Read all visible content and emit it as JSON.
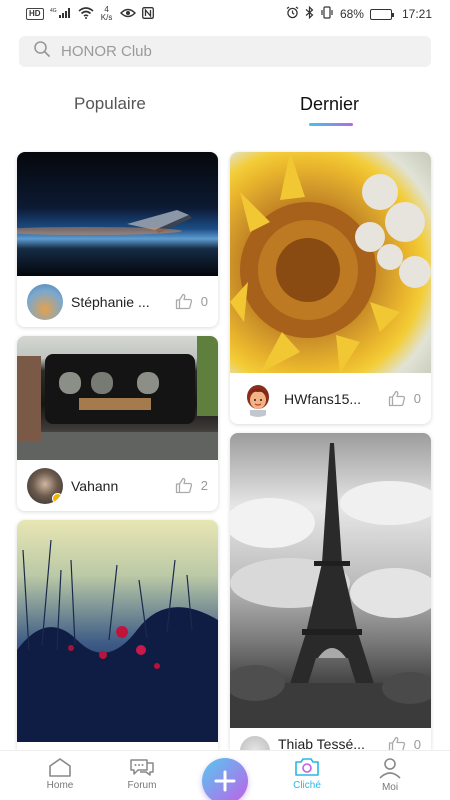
{
  "status_bar": {
    "hd": "HD",
    "net_type": "4G",
    "speed_value": "4",
    "speed_unit": "K/s",
    "battery": "68%",
    "battery_level": 0.68,
    "time": "17:21"
  },
  "search": {
    "placeholder": "HONOR Club"
  },
  "tabs": [
    {
      "label": "Populaire",
      "active": false
    },
    {
      "label": "Dernier",
      "active": true
    }
  ],
  "feed": {
    "left": [
      {
        "author": "Stéphanie ...",
        "likes": "0",
        "image": "night-sky-airplane-wing"
      },
      {
        "author": "Vahann",
        "likes": "2",
        "image": "steam-locomotive"
      },
      {
        "author": "",
        "likes": "",
        "image": "poppies-field-dusk"
      }
    ],
    "right": [
      {
        "author": "HWfans15...",
        "likes": "0",
        "image": "sunflower-closeup"
      },
      {
        "author": "Thiab Tessé...",
        "likes": "0",
        "image": "eiffel-tower-bw"
      }
    ]
  },
  "bottom_nav": [
    {
      "label": "Home",
      "icon": "home-icon",
      "active": false
    },
    {
      "label": "Forum",
      "icon": "forum-icon",
      "active": false
    },
    {
      "label": "",
      "icon": "plus-icon",
      "active": false
    },
    {
      "label": "Cliché",
      "icon": "camera-icon",
      "active": true
    },
    {
      "label": "Moi",
      "icon": "profile-icon",
      "active": false
    }
  ],
  "colors": {
    "accent": "#2ab7e3",
    "gradient_start": "#55c9ef",
    "gradient_end": "#c15fe9"
  }
}
